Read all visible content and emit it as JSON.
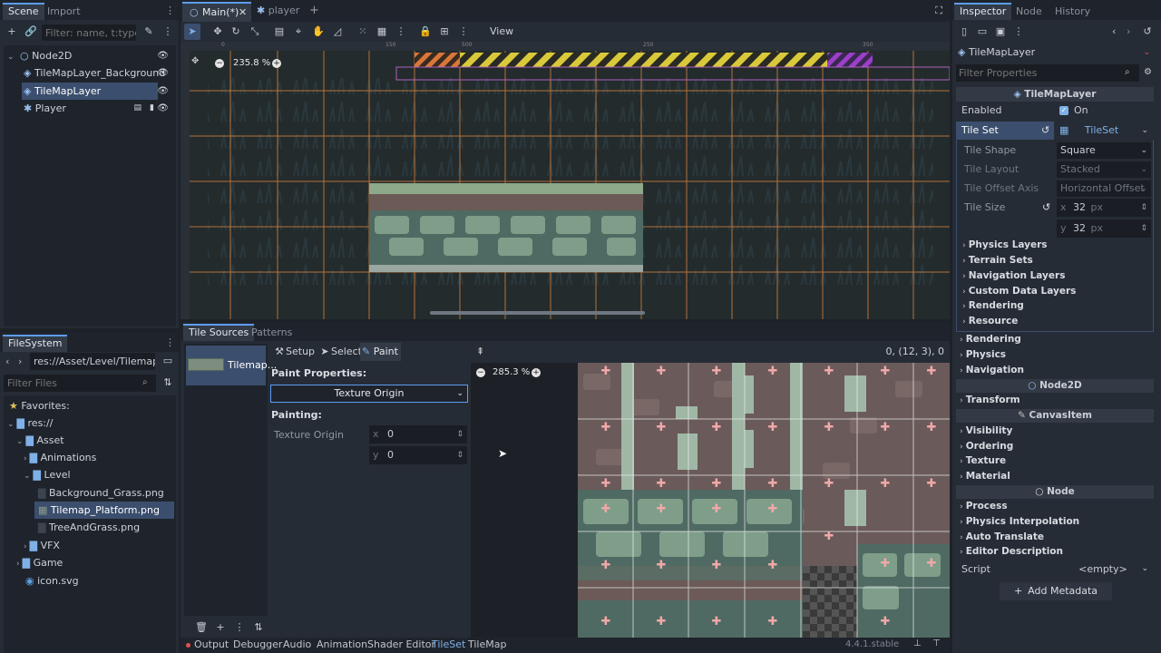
{
  "scene_dock": {
    "tabs": [
      "Scene",
      "Import"
    ],
    "filter_placeholder": "Filter: name, t:type,",
    "nodes": [
      {
        "label": "Node2D"
      },
      {
        "label": "TileMapLayer_Background"
      },
      {
        "label": "TileMapLayer"
      },
      {
        "label": "Player"
      }
    ]
  },
  "filesystem": {
    "tab": "FileSystem",
    "path": "res://Asset/Level/Tilemap_Pla",
    "filter_placeholder": "Filter Files",
    "items": [
      {
        "label": "Favorites:"
      },
      {
        "label": "res://"
      },
      {
        "label": "Asset"
      },
      {
        "label": "Animations"
      },
      {
        "label": "Level"
      },
      {
        "label": "Background_Grass.png"
      },
      {
        "label": "Tilemap_Platform.png"
      },
      {
        "label": "TreeAndGrass.png"
      },
      {
        "label": "VFX"
      },
      {
        "label": "Game"
      },
      {
        "label": "icon.svg"
      }
    ]
  },
  "editor_tabs": [
    {
      "label": "Main(*)"
    },
    {
      "label": "player"
    }
  ],
  "toolbar": {
    "view_label": "View"
  },
  "viewport": {
    "zoom": "235.8 %",
    "ruler_marks": [
      "0",
      "150",
      "500",
      "250",
      "350"
    ]
  },
  "tileset_panel": {
    "tabs": [
      "Tile Sources",
      "Patterns"
    ],
    "source_label": "Tilemap...",
    "modes": {
      "setup": "Setup",
      "select": "Select",
      "paint": "Paint"
    },
    "paint_properties_label": "Paint Properties:",
    "paint_property_selected": "Texture Origin",
    "painting_label": "Painting:",
    "texture_origin_label": "Texture Origin",
    "texture_origin_x": "0",
    "texture_origin_y": "0",
    "zoom": "285.3 %",
    "coords": "0, (12, 3), 0"
  },
  "inspector": {
    "tabs": [
      "Inspector",
      "Node",
      "History"
    ],
    "object_name": "TileMapLayer",
    "filter_placeholder": "Filter Properties",
    "class_header": "TileMapLayer",
    "enabled_label": "Enabled",
    "enabled_value": "On",
    "tile_set_label": "Tile Set",
    "tile_set_value": "TileSet",
    "tile_shape_label": "Tile Shape",
    "tile_shape_value": "Square",
    "tile_layout_label": "Tile Layout",
    "tile_layout_value": "Stacked",
    "tile_offset_label": "Tile Offset Axis",
    "tile_offset_value": "Horizontal Offset",
    "tile_size_label": "Tile Size",
    "tile_size_x": "32",
    "tile_size_y": "32",
    "unit": "px",
    "tileset_sections": [
      "Physics Layers",
      "Terrain Sets",
      "Navigation Layers",
      "Custom Data Layers",
      "Rendering",
      "Resource"
    ],
    "layer_sections": [
      "Rendering",
      "Physics",
      "Navigation"
    ],
    "node2d_header": "Node2D",
    "node2d_sections": [
      "Transform"
    ],
    "canvasitem_header": "CanvasItem",
    "canvasitem_sections": [
      "Visibility",
      "Ordering",
      "Texture",
      "Material"
    ],
    "node_header": "Node",
    "node_sections": [
      "Process",
      "Physics Interpolation",
      "Auto Translate",
      "Editor Description"
    ],
    "script_label": "Script",
    "script_value": "<empty>",
    "add_metadata": "Add Metadata"
  },
  "bottom_bar": {
    "tabs": [
      "Output",
      "Debugger",
      "Audio",
      "Animation",
      "Shader Editor",
      "TileSet",
      "TileMap"
    ],
    "version": "4.4.1.stable"
  },
  "colors": {
    "accent": "#5d9df0",
    "selection": "#3b4e6d",
    "panel": "#262c35",
    "background": "#1d2229"
  }
}
